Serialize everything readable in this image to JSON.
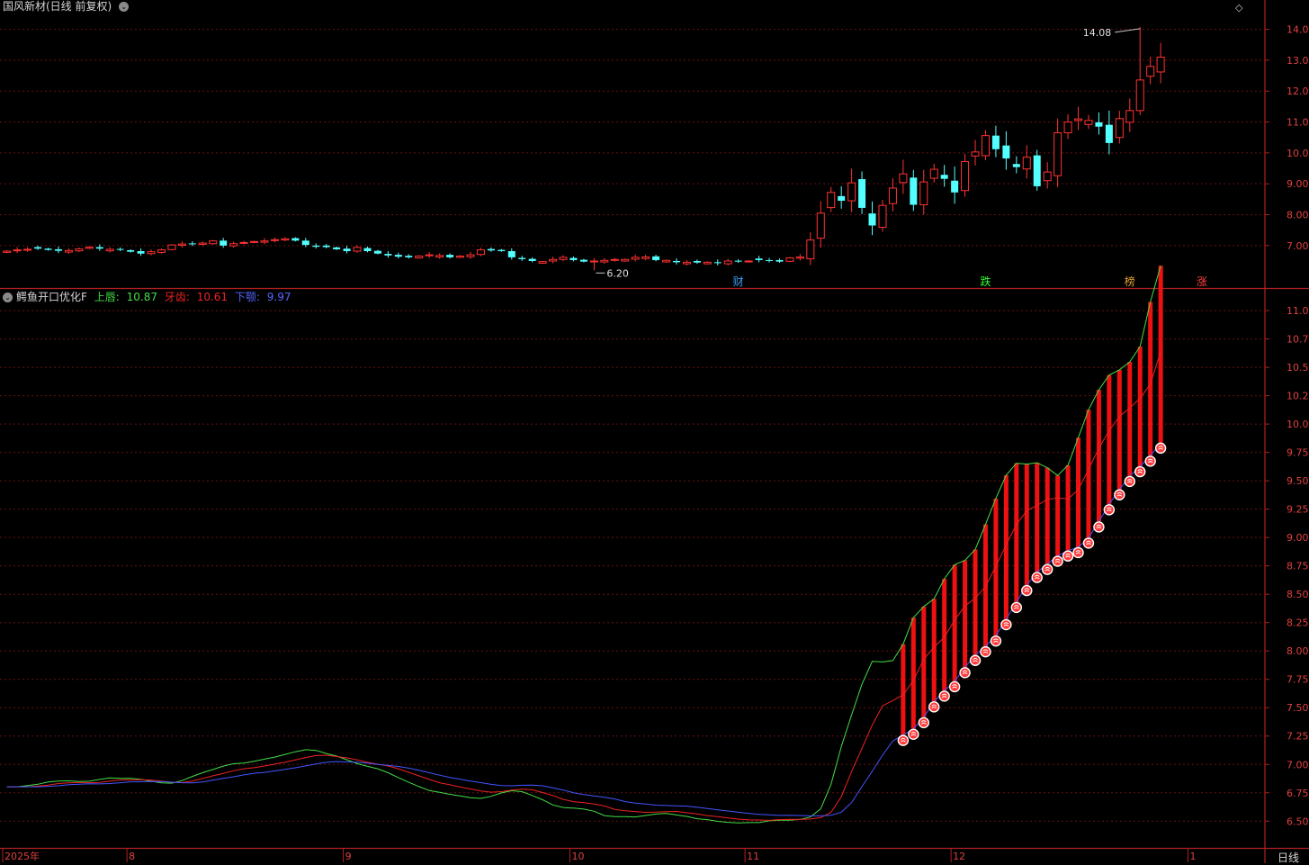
{
  "top_header": {
    "title": "国风新材(日线 前复权)"
  },
  "indicator_header": {
    "name": "鳄鱼开口优化F",
    "lines": [
      {
        "label": "上唇",
        "value": "10.87",
        "color": "#44dd44"
      },
      {
        "label": "牙齿",
        "value": "10.61",
        "color": "#ee2222"
      },
      {
        "label": "下颚",
        "value": "9.97",
        "color": "#4455ff"
      }
    ]
  },
  "period_label": "日线",
  "chart_data": [
    {
      "type": "candlestick",
      "title": "国风新材(日线 前复权)",
      "yticks": [
        "14.00",
        "13.00",
        "12.00",
        "11.00",
        "10.00",
        "9.00",
        "8.00",
        "7.00"
      ],
      "ylim": [
        5.8,
        14.6
      ],
      "up_color": "#ff3232",
      "down_color": "#54ffff",
      "annotations": [
        {
          "text": "14.08",
          "type": "high"
        },
        {
          "text": "6.20",
          "type": "low"
        }
      ],
      "event_markers": [
        {
          "text": "财",
          "color": "#3aa0ff"
        },
        {
          "text": "跌",
          "color": "#33ff33"
        },
        {
          "text": "榜",
          "color": "#e0a030"
        },
        {
          "text": "涨",
          "color": "#ff4040"
        }
      ],
      "close": [
        6.82,
        6.86,
        6.88,
        6.9,
        6.86,
        6.83,
        6.84,
        6.89,
        6.95,
        6.9,
        6.88,
        6.86,
        6.8,
        6.74,
        6.8,
        6.86,
        7.02,
        7.05,
        7.04,
        7.08,
        7.15,
        7.0,
        7.06,
        7.1,
        7.13,
        7.15,
        7.19,
        7.22,
        7.16,
        7.02,
        6.96,
        6.95,
        6.88,
        6.82,
        6.94,
        6.82,
        6.74,
        6.68,
        6.64,
        6.62,
        6.66,
        6.7,
        6.68,
        6.62,
        6.66,
        6.7,
        6.86,
        6.84,
        6.82,
        6.62,
        6.56,
        6.5,
        6.48,
        6.55,
        6.62,
        6.53,
        6.48,
        6.5,
        6.52,
        6.55,
        6.55,
        6.62,
        6.63,
        6.53,
        6.52,
        6.46,
        6.46,
        6.45,
        6.46,
        6.43,
        6.5,
        6.48,
        6.5,
        6.53,
        6.51,
        6.48,
        6.6,
        6.63,
        7.18,
        8.05,
        8.72,
        8.45,
        9.03,
        8.22,
        7.65,
        8.3,
        8.86,
        9.32,
        8.32,
        9.06,
        9.47,
        9.16,
        8.72,
        9.72,
        10.03,
        10.56,
        10.12,
        9.82,
        9.54,
        9.86,
        8.92,
        9.38,
        10.65,
        11.0,
        11.1,
        11.05,
        10.85,
        10.32,
        11.11,
        11.37,
        12.36,
        12.8,
        13.1
      ],
      "date_ticks": [
        {
          "label": "2025年"
        },
        {
          "label": "8"
        },
        {
          "label": "9"
        },
        {
          "label": "10"
        },
        {
          "label": "11"
        },
        {
          "label": "12"
        },
        {
          "label": "1"
        }
      ]
    },
    {
      "type": "line",
      "title": "鳄鱼开口优化F",
      "yticks": [
        "11.00",
        "10.75",
        "10.50",
        "10.25",
        "10.00",
        "9.75",
        "9.50",
        "9.25",
        "9.00",
        "8.75",
        "8.50",
        "8.25",
        "8.00",
        "7.75",
        "7.50",
        "7.25",
        "7.00",
        "6.75",
        "6.50"
      ],
      "ylim": [
        6.28,
        11.08
      ],
      "series": [
        {
          "name": "上唇",
          "color": "#44dd44"
        },
        {
          "name": "牙齿",
          "color": "#ee2222"
        },
        {
          "name": "下颚",
          "color": "#4455ff"
        }
      ],
      "bar_color": "#ee1111",
      "signal_color": "#ff3a3a"
    }
  ]
}
